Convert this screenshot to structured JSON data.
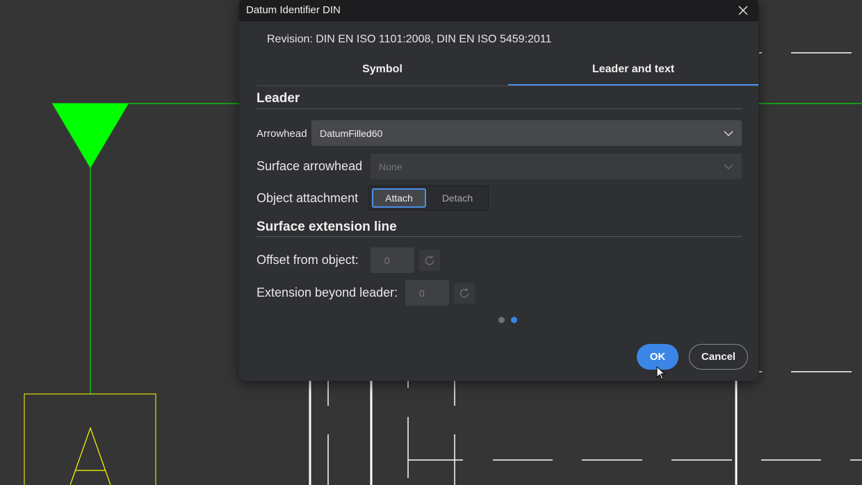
{
  "dialog": {
    "title": "Datum Identifier DIN",
    "revision": "Revision: DIN EN ISO 1101:2008, DIN EN ISO 5459:2011"
  },
  "tabs": [
    {
      "label": "Symbol",
      "active": false
    },
    {
      "label": "Leader and text",
      "active": true
    }
  ],
  "leader": {
    "section_title": "Leader",
    "arrowhead_label": "Arrowhead",
    "arrowhead_value": "DatumFilled60",
    "surface_arrowhead_label": "Surface arrowhead",
    "surface_arrowhead_value": "None",
    "object_attachment_label": "Object attachment",
    "attach_label": "Attach",
    "detach_label": "Detach",
    "selected_attachment": "Attach"
  },
  "surface_extension": {
    "section_title": "Surface extension line",
    "offset_label": "Offset from object:",
    "offset_value": "0",
    "extension_label": "Extension beyond leader:",
    "extension_value": "0"
  },
  "pager": {
    "pages": 2,
    "current": 2
  },
  "buttons": {
    "ok": "OK",
    "cancel": "Cancel"
  },
  "drawing": {
    "datum_letter": "A"
  },
  "colors": {
    "accent": "#3b86e6",
    "cad_green": "#00ff00",
    "cad_yellow": "#ffff00",
    "cad_background": "#353535"
  }
}
